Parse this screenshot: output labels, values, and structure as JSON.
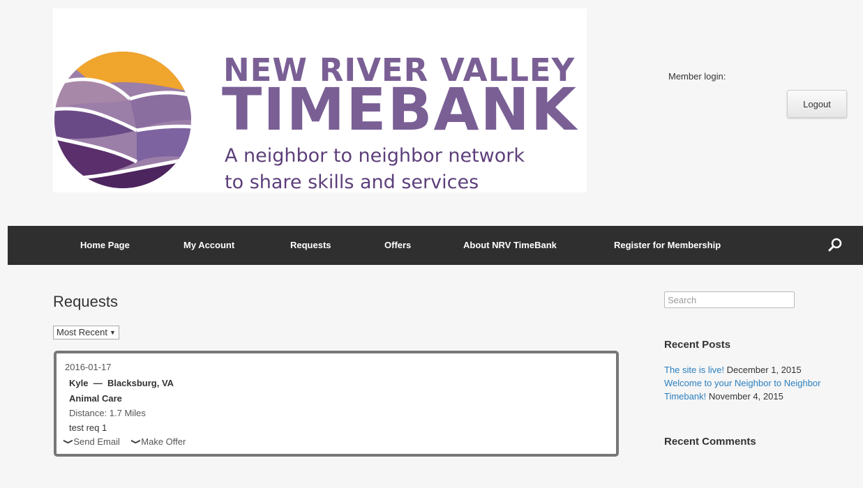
{
  "logo": {
    "line1": "NEW RIVER VALLEY",
    "line2": "TIMEBANK",
    "tagline1": "A neighbor to neighbor network",
    "tagline2": "to share skills and services"
  },
  "header": {
    "member_login": "Member login:",
    "logout": "Logout"
  },
  "nav": {
    "items": [
      "Home Page",
      "My Account",
      "Requests",
      "Offers",
      "About NRV TimeBank",
      "Register for Membership"
    ]
  },
  "main": {
    "title": "Requests",
    "sort": "Most Recent",
    "request": {
      "date": "2016-01-17",
      "user": "Kyle",
      "location": "Blacksburg, VA",
      "category": "Animal Care",
      "distance": "Distance: 1.7 Miles",
      "description": "test req 1",
      "send_email": "Send Email",
      "make_offer": "Make Offer"
    }
  },
  "sidebar": {
    "search_placeholder": "Search",
    "recent_posts_title": "Recent Posts",
    "posts": [
      {
        "title": "The site is live!",
        "date": "December 1, 2015"
      },
      {
        "title": "Welcome to your Neighbor to Neighbor Timebank!",
        "date": "November 4, 2015"
      }
    ],
    "recent_comments_title": "Recent Comments"
  },
  "colors": {
    "brand_purple": "#7a5f95",
    "nav_bg": "#2f2f2f",
    "link": "#2a7fbf"
  }
}
